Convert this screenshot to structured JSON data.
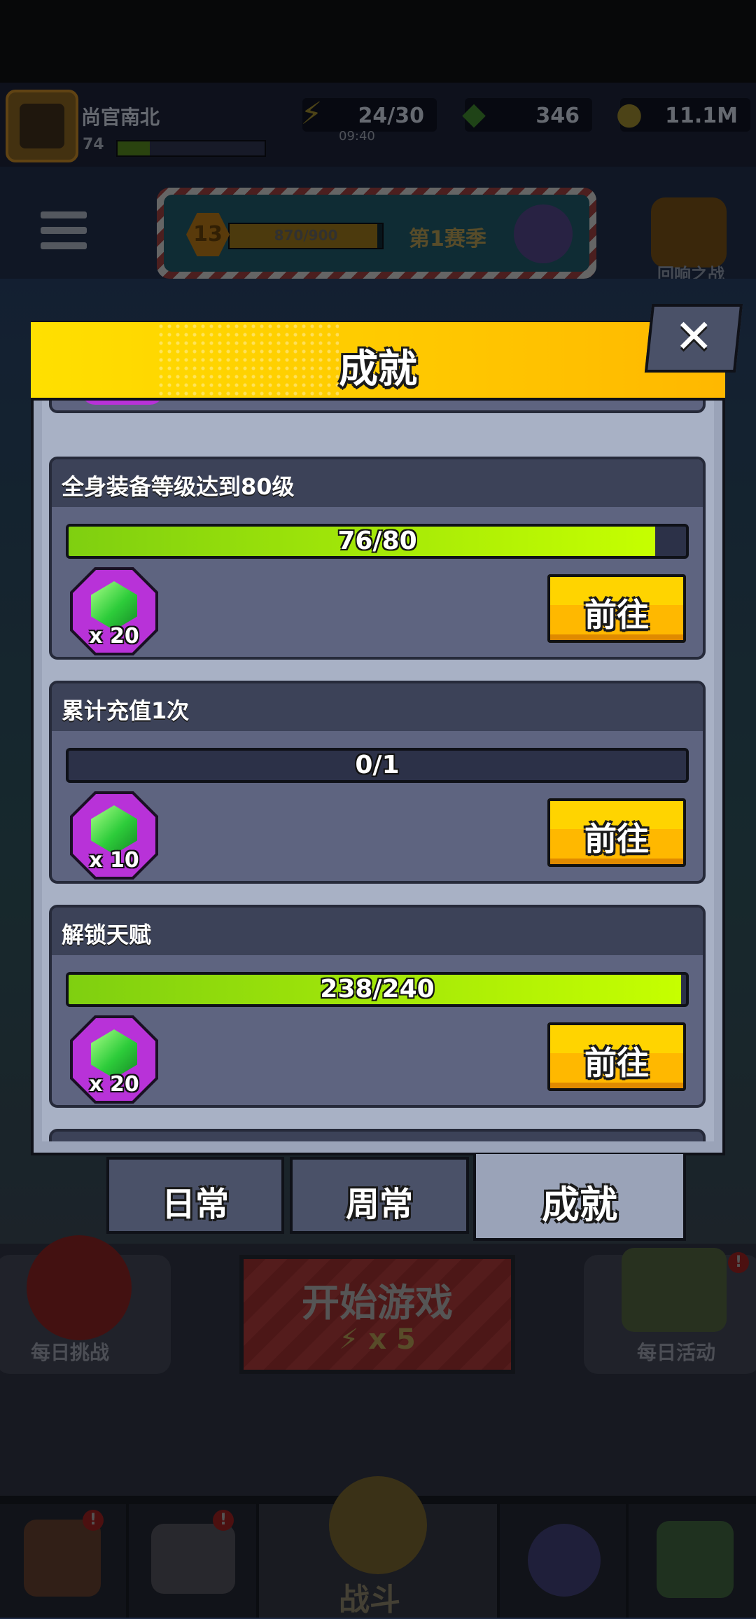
{
  "hud": {
    "player_name": "尚官南北",
    "player_level": "74",
    "xp_fraction": 0.22,
    "energy": "24/30",
    "energy_timer": "09:40",
    "gems": "346",
    "coins": "11.1M"
  },
  "season": {
    "level": "13",
    "progress": "870/900",
    "progress_fraction": 0.967,
    "name": "第1赛季"
  },
  "echo_battle_label": "回响之战",
  "modal": {
    "title": "成就",
    "close_label": "✕",
    "achievements": [
      {
        "title": "全身装备等级达到80级",
        "progress": "76/80",
        "fraction": 0.95,
        "reward_qty": "x 20",
        "reward_icon": "green-gem-icon",
        "button": "前往"
      },
      {
        "title": "累计充值1次",
        "progress": "0/1",
        "fraction": 0.0,
        "reward_qty": "x 10",
        "reward_icon": "green-gem-icon",
        "button": "前往"
      },
      {
        "title": "解锁天赋",
        "progress": "238/240",
        "fraction": 0.992,
        "reward_qty": "x 20",
        "reward_icon": "green-gem-icon",
        "button": "前往"
      }
    ]
  },
  "tabs": [
    {
      "label": "日常",
      "active": false
    },
    {
      "label": "周常",
      "active": false
    },
    {
      "label": "成就",
      "active": true
    }
  ],
  "background": {
    "daily_challenge": "每日挑战",
    "start_game": "开始游戏",
    "start_cost": "⚡ x 5",
    "daily_activity": "每日活动",
    "battle": "战斗",
    "badge": "!"
  },
  "colors": {
    "header_yellow": "#ffd000",
    "progress_green": "#b8ff00",
    "button_orange": "#ffb800",
    "reward_purple": "#b832d8"
  }
}
